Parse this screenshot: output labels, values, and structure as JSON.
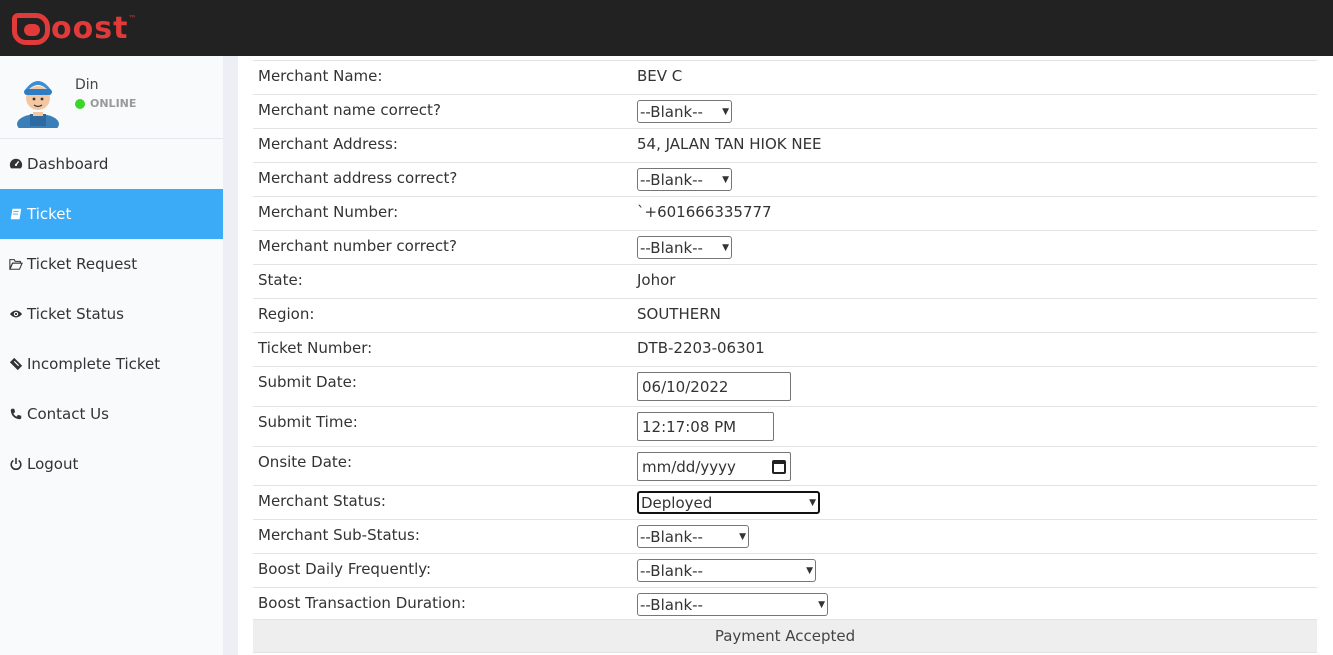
{
  "brand": {
    "name": "oost",
    "tm": "™"
  },
  "user": {
    "name": "Din",
    "status": "ONLINE"
  },
  "sidebar": {
    "items": [
      {
        "label": "Dashboard",
        "icon": "dashboard-icon"
      },
      {
        "label": "Ticket",
        "icon": "book-icon",
        "active": true
      },
      {
        "label": "Ticket Request",
        "icon": "folder-open-icon"
      },
      {
        "label": "Ticket Status",
        "icon": "eye-icon"
      },
      {
        "label": "Incomplete Ticket",
        "icon": "ticket-icon"
      },
      {
        "label": "Contact Us",
        "icon": "phone-icon"
      },
      {
        "label": "Logout",
        "icon": "power-icon"
      }
    ]
  },
  "form": {
    "merchant_name": {
      "label": "Merchant Name:",
      "value": "BEV C"
    },
    "merchant_name_correct": {
      "label": "Merchant name correct?",
      "value": "--Blank--"
    },
    "merchant_address": {
      "label": "Merchant Address:",
      "value": "54, JALAN TAN HIOK NEE"
    },
    "merchant_address_correct": {
      "label": "Merchant address correct?",
      "value": "--Blank--"
    },
    "merchant_number": {
      "label": "Merchant Number:",
      "value": "`+601666335777"
    },
    "merchant_number_correct": {
      "label": "Merchant number correct?",
      "value": "--Blank--"
    },
    "state": {
      "label": "State:",
      "value": "Johor"
    },
    "region": {
      "label": "Region:",
      "value": "SOUTHERN"
    },
    "ticket_number": {
      "label": "Ticket Number:",
      "value": "DTB-2203-06301"
    },
    "submit_date": {
      "label": "Submit Date:",
      "value": "06/10/2022"
    },
    "submit_time": {
      "label": "Submit Time:",
      "value": "12:17:08 PM"
    },
    "onsite_date": {
      "label": "Onsite Date:",
      "placeholder": "mm/dd/yyyy"
    },
    "merchant_status": {
      "label": "Merchant Status:",
      "value": "Deployed"
    },
    "merchant_sub_status": {
      "label": "Merchant Sub-Status:",
      "value": "--Blank--"
    },
    "boost_daily": {
      "label": "Boost Daily Frequently:",
      "value": "--Blank--"
    },
    "boost_duration": {
      "label": "Boost Transaction Duration:",
      "value": "--Blank--"
    }
  },
  "footer": {
    "payment_label": "Payment Accepted"
  },
  "colors": {
    "topbar": "#222222",
    "brand": "#e03a3a",
    "active": "#3cabf7",
    "online": "#3bd62a"
  }
}
